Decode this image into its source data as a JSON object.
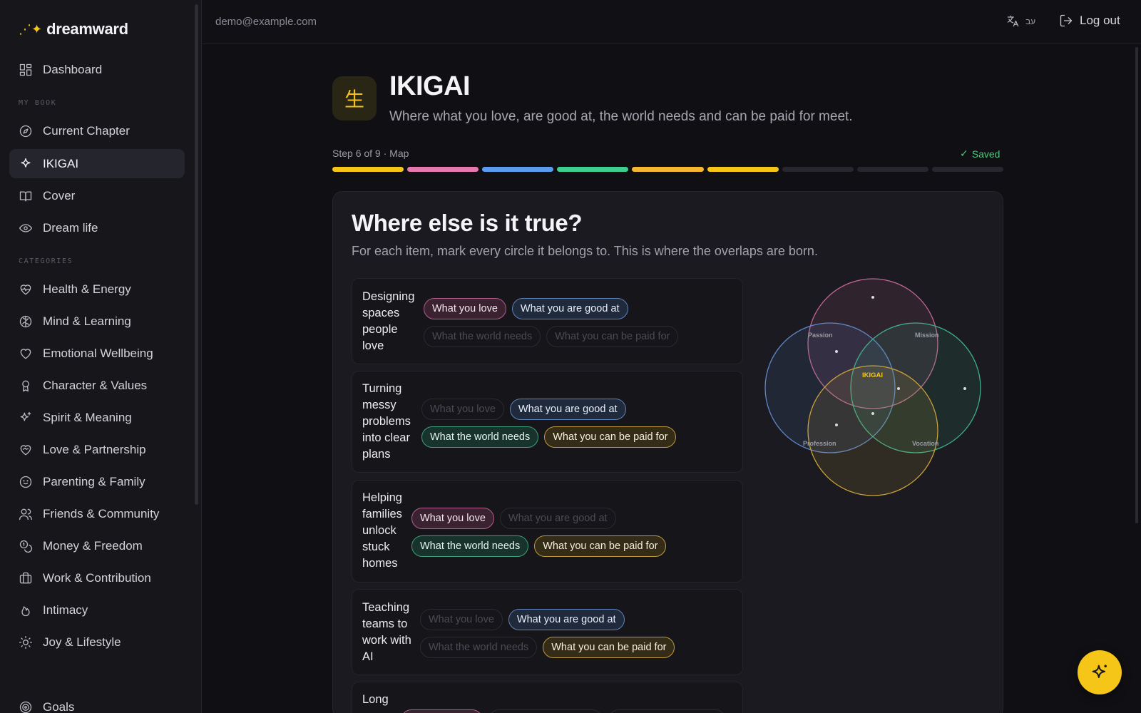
{
  "brand": {
    "name": "dreamward"
  },
  "sidebar": {
    "dashboard": "Dashboard",
    "my_book_label": "MY BOOK",
    "book_items": [
      "Current Chapter",
      "IKIGAI",
      "Cover",
      "Dream life"
    ],
    "categories_label": "CATEGORIES",
    "categories": [
      "Health & Energy",
      "Mind & Learning",
      "Emotional Wellbeing",
      "Character & Values",
      "Spirit & Meaning",
      "Love & Partnership",
      "Parenting & Family",
      "Friends & Community",
      "Money & Freedom",
      "Work & Contribution",
      "Intimacy",
      "Joy & Lifestyle"
    ],
    "goals": "Goals"
  },
  "topbar": {
    "email": "demo@example.com",
    "lang_label": "עב",
    "logout": "Log out"
  },
  "header": {
    "icon_glyph": "生",
    "title": "IKIGAI",
    "subtitle": "Where what you love, are good at, the world needs and can be paid for meet."
  },
  "progress": {
    "step_label": "Step 6 of 9 · Map",
    "saved_label": "Saved",
    "total_steps": 9,
    "completed_steps": 6,
    "colors": [
      "#f5c518",
      "#e879b0",
      "#5b9bf0",
      "#3ecf8e",
      "#f5b732",
      "#f5c518"
    ]
  },
  "card": {
    "title": "Where else is it true?",
    "subtitle": "For each item, mark every circle it belongs to. This is where the overlaps are born.",
    "tag_labels": {
      "love": "What you love",
      "good": "What you are good at",
      "needs": "What the world needs",
      "paid": "What you can be paid for"
    },
    "items": [
      {
        "text": "Designing spaces people love",
        "love": true,
        "good": true,
        "needs": false,
        "paid": false
      },
      {
        "text": "Turning messy problems into clear plans",
        "love": false,
        "good": true,
        "needs": true,
        "paid": true
      },
      {
        "text": "Helping families unlock stuck homes",
        "love": true,
        "good": false,
        "needs": true,
        "paid": true
      },
      {
        "text": "Teaching teams to work with AI",
        "love": false,
        "good": true,
        "needs": false,
        "paid": true
      },
      {
        "text": "Long"
      }
    ]
  },
  "venn": {
    "labels": {
      "passion": "Passion",
      "mission": "Mission",
      "profession": "Profession",
      "vocation": "Vocation",
      "center": "IKIGAI"
    },
    "colors": {
      "love": "#c2668f",
      "good": "#5f86c6",
      "needs": "#3fae86",
      "paid": "#c9a13c",
      "center": "#f5c518"
    }
  },
  "colors": {
    "accent": "#f5c518",
    "saved": "#4fc77f"
  }
}
